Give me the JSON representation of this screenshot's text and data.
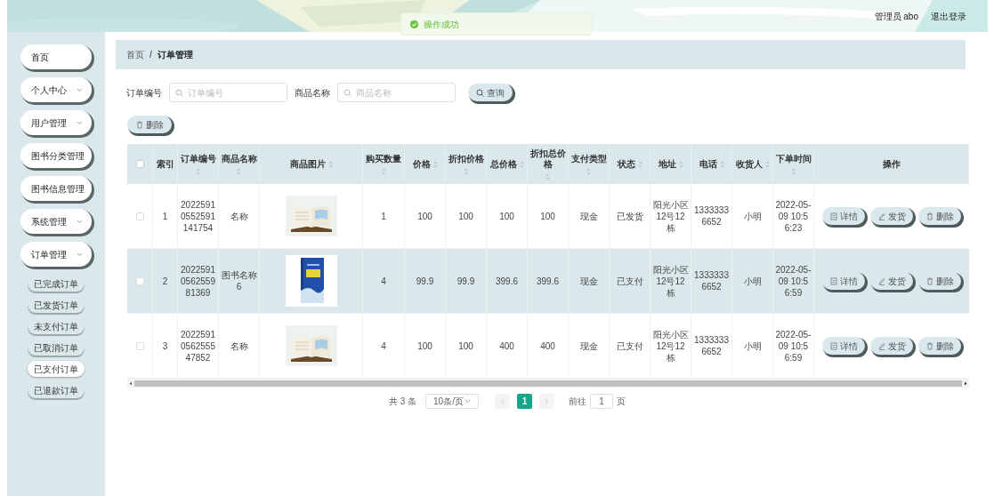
{
  "header": {
    "user_label": "管理员 abo",
    "logout": "退出登录"
  },
  "toast": {
    "message": "操作成功"
  },
  "sidebar": {
    "items": [
      {
        "label": "首页",
        "expandable": false
      },
      {
        "label": "个人中心",
        "expandable": true
      },
      {
        "label": "用户管理",
        "expandable": true
      },
      {
        "label": "图书分类管理",
        "expandable": false
      },
      {
        "label": "图书信息管理",
        "expandable": false
      },
      {
        "label": "系统管理",
        "expandable": true
      },
      {
        "label": "订单管理",
        "expandable": true,
        "children": [
          {
            "label": "已完成订单",
            "selected": false
          },
          {
            "label": "已发货订单",
            "selected": false
          },
          {
            "label": "未支付订单",
            "selected": false
          },
          {
            "label": "已取消订单",
            "selected": false
          },
          {
            "label": "已支付订单",
            "selected": true
          },
          {
            "label": "已退款订单",
            "selected": false
          }
        ]
      }
    ]
  },
  "breadcrumb": {
    "items": [
      "首页",
      "订单管理"
    ],
    "separator": "/"
  },
  "search": {
    "fields": [
      {
        "label": "订单编号",
        "placeholder": "订单编号"
      },
      {
        "label": "商品名称",
        "placeholder": "商品名称"
      }
    ],
    "button": "查询"
  },
  "delete_button": "删除",
  "table": {
    "select_all": {
      "checked": false
    },
    "columns": [
      {
        "kind": "text",
        "label": "索引",
        "sortable": false
      },
      {
        "kind": "text",
        "label": "订单编号",
        "sortable": true
      },
      {
        "kind": "text",
        "label": "商品名称",
        "sortable": true
      },
      {
        "label": "商品图片",
        "sortable": true
      },
      {
        "kind": "text",
        "label": "购买数量",
        "sortable": true
      },
      {
        "kind": "text",
        "label": "价格",
        "sortable": true
      },
      {
        "kind": "text",
        "label": "折扣价格",
        "sortable": true
      },
      {
        "kind": "text",
        "label": "总价格",
        "sortable": true
      },
      {
        "kind": "text",
        "label": "折扣总价格",
        "sortable": true
      },
      {
        "kind": "text",
        "label": "支付类型",
        "sortable": true
      },
      {
        "kind": "text",
        "label": "状态",
        "sortable": true
      },
      {
        "kind": "text",
        "label": "地址",
        "sortable": true
      },
      {
        "kind": "text",
        "label": "电话",
        "sortable": true
      },
      {
        "kind": "text",
        "label": "收货人",
        "sortable": true
      },
      {
        "kind": "text",
        "label": "下单时间",
        "sortable": true
      },
      {
        "kind": "actions",
        "label": "操作",
        "sortable": false
      }
    ],
    "rows": [
      {
        "checked": false,
        "hovered": false,
        "cells": [
          "1",
          "20225910552591141754",
          "名称",
          "",
          "1",
          "100",
          "100",
          "100",
          "100",
          "现金",
          "已发货",
          "阳光小区12号12栋",
          "13333336652",
          "小明",
          "2022-05-09 10:56:23"
        ],
        "actions": [
          {
            "kind": "detail",
            "label": "详情"
          },
          {
            "kind": "ship",
            "label": "发货"
          },
          {
            "kind": "delete",
            "label": "删除"
          }
        ]
      },
      {
        "checked": false,
        "hovered": true,
        "cells": [
          "2",
          "2022591056255981369",
          "图书名称6",
          "",
          "4",
          "99.9",
          "99.9",
          "399.6",
          "399.6",
          "现金",
          "已支付",
          "阳光小区12号12栋",
          "13333336652",
          "小明",
          "2022-05-09 10:56:59"
        ],
        "actions": [
          {
            "kind": "detail",
            "label": "详情"
          },
          {
            "kind": "ship",
            "label": "发货"
          },
          {
            "kind": "delete",
            "label": "删除"
          }
        ]
      },
      {
        "checked": false,
        "hovered": false,
        "cells": [
          "3",
          "2022591056255547852",
          "名称",
          "",
          "4",
          "100",
          "100",
          "400",
          "400",
          "现金",
          "已支付",
          "阳光小区12号12栋",
          "13333336652",
          "小明",
          "2022-05-09 10:56:59"
        ],
        "actions": [
          {
            "kind": "detail",
            "label": "详情"
          },
          {
            "kind": "ship",
            "label": "发货"
          },
          {
            "kind": "delete",
            "label": "删除"
          }
        ]
      }
    ]
  },
  "pagination": {
    "total": "共 3 条",
    "page_size": "10条/页",
    "pages": [
      {
        "label": "1",
        "selected": true
      }
    ],
    "goto_label": "前往",
    "goto_value": "1",
    "page_suffix": "页"
  }
}
